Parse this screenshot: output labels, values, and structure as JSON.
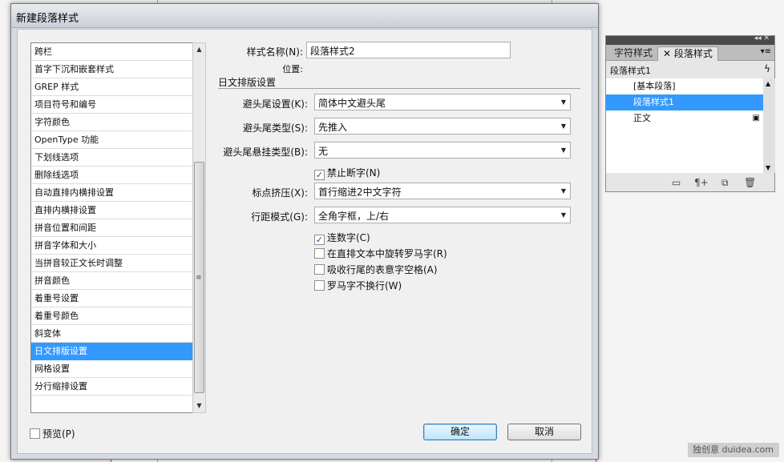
{
  "dialog": {
    "title": "新建段落样式",
    "categories": [
      "跨栏",
      "首字下沉和嵌套样式",
      "GREP 样式",
      "项目符号和编号",
      "字符颜色",
      "OpenType 功能",
      "下划线选项",
      "删除线选项",
      "自动直排内横排设置",
      "直排内横排设置",
      "拼音位置和间距",
      "拼音字体和大小",
      "当拼音较正文长时调整",
      "拼音颜色",
      "着重号设置",
      "着重号颜色",
      "斜变体",
      "日文排版设置",
      "网格设置",
      "分行缩排设置"
    ],
    "selected_category": "日文排版设置",
    "style_name_label": "样式名称(N):",
    "style_name_value": "段落样式2",
    "location_label": "位置:",
    "section_title": "日文排版设置",
    "fields": {
      "kinsoku_set_label": "避头尾设置(K):",
      "kinsoku_set_value": "简体中文避头尾",
      "kinsoku_type_label": "避头尾类型(S):",
      "kinsoku_type_value": "先推入",
      "hanging_type_label": "避头尾悬挂类型(B):",
      "hanging_type_value": "无",
      "mojikumi_label": "标点挤压(X):",
      "mojikumi_value": "首行缩进2中文字符",
      "leading_model_label": "行距模式(G):",
      "leading_model_value": "全角字框，上/右"
    },
    "checkboxes": {
      "no_break": "禁止断字(N)",
      "tcy_digits": "连数字(C)",
      "rotate_roman": "在直排文本中旋转罗马字(R)",
      "absorb_space": "吸收行尾的表意字空格(A)",
      "roman_no_wrap": "罗马字不换行(W)"
    },
    "preview_label": "预览(P)",
    "ok_label": "确定",
    "cancel_label": "取消"
  },
  "panel": {
    "tab_char": "字符样式",
    "tab_para": "段落样式",
    "current_style": "段落样式1",
    "styles": [
      "[基本段落]",
      "段落样式1",
      "正文"
    ],
    "selected_style": "段落样式1"
  },
  "watermark": "独创意 duidea.com",
  "colors": {
    "selection": "#3399ff",
    "check": "#2a4b9b"
  },
  "icons": [
    "chevron-up-icon",
    "chevron-down-icon",
    "grip-icon",
    "lightning-icon",
    "save-icon",
    "folder-icon",
    "clear-overrides-icon",
    "new-style-icon",
    "trash-icon",
    "panel-menu-icon"
  ]
}
